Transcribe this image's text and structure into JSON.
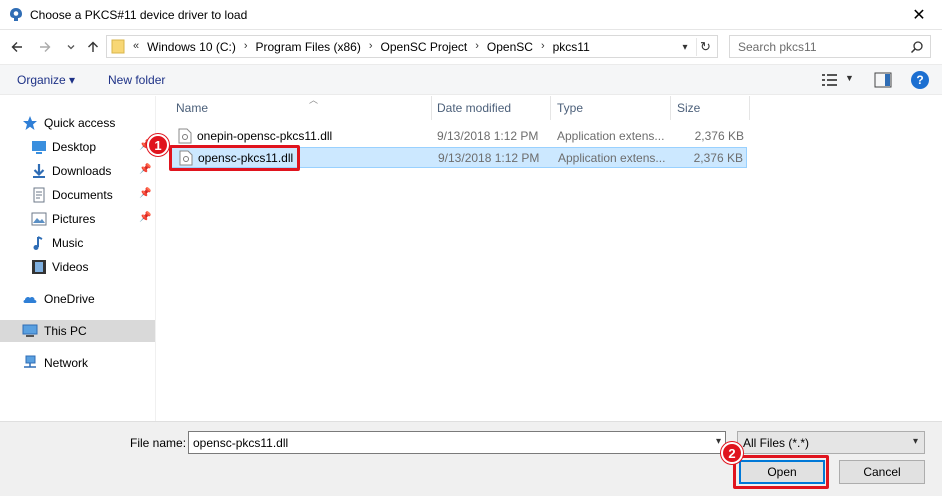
{
  "window": {
    "title": "Choose a PKCS#11 device driver to load",
    "close_symbol": "✕"
  },
  "address": {
    "prefix": "«",
    "crumbs": [
      "Windows 10 (C:)",
      "Program Files (x86)",
      "OpenSC Project",
      "OpenSC",
      "pkcs11"
    ]
  },
  "search": {
    "placeholder": "Search pkcs11"
  },
  "toolbar": {
    "organize_label": "Organize ▾",
    "new_folder_label": "New folder",
    "help_label": "?"
  },
  "sidebar": {
    "items": [
      {
        "label": "Quick access",
        "icon": "star-icon",
        "pinned": false
      },
      {
        "label": "Desktop",
        "icon": "desktop-icon",
        "pinned": true
      },
      {
        "label": "Downloads",
        "icon": "download-icon",
        "pinned": true
      },
      {
        "label": "Documents",
        "icon": "document-icon",
        "pinned": true
      },
      {
        "label": "Pictures",
        "icon": "picture-icon",
        "pinned": true
      },
      {
        "label": "Music",
        "icon": "music-icon",
        "pinned": false
      },
      {
        "label": "Videos",
        "icon": "video-icon",
        "pinned": false
      },
      {
        "label": "OneDrive",
        "icon": "cloud-icon",
        "pinned": false
      },
      {
        "label": "This PC",
        "icon": "computer-icon",
        "pinned": false
      },
      {
        "label": "Network",
        "icon": "network-icon",
        "pinned": false
      }
    ],
    "selected": "This PC"
  },
  "columns": {
    "name": "Name",
    "date": "Date modified",
    "type": "Type",
    "size": "Size"
  },
  "files": [
    {
      "name": "onepin-opensc-pkcs11.dll",
      "date": "9/13/2018 1:12 PM",
      "type": "Application extens...",
      "size": "2,376 KB",
      "selected": false
    },
    {
      "name": "opensc-pkcs11.dll",
      "date": "9/13/2018 1:12 PM",
      "type": "Application extens...",
      "size": "2,376 KB",
      "selected": true
    }
  ],
  "footer": {
    "filename_label": "File name:",
    "filename_value": "opensc-pkcs11.dll",
    "filter_value": "All Files (*.*)",
    "open_label": "Open",
    "cancel_label": "Cancel"
  },
  "annotations": {
    "marker1": "1",
    "marker2": "2",
    "highlight_color": "#e0141e"
  },
  "colors": {
    "accent": "#0078d7",
    "selection": "#cce8ff"
  }
}
